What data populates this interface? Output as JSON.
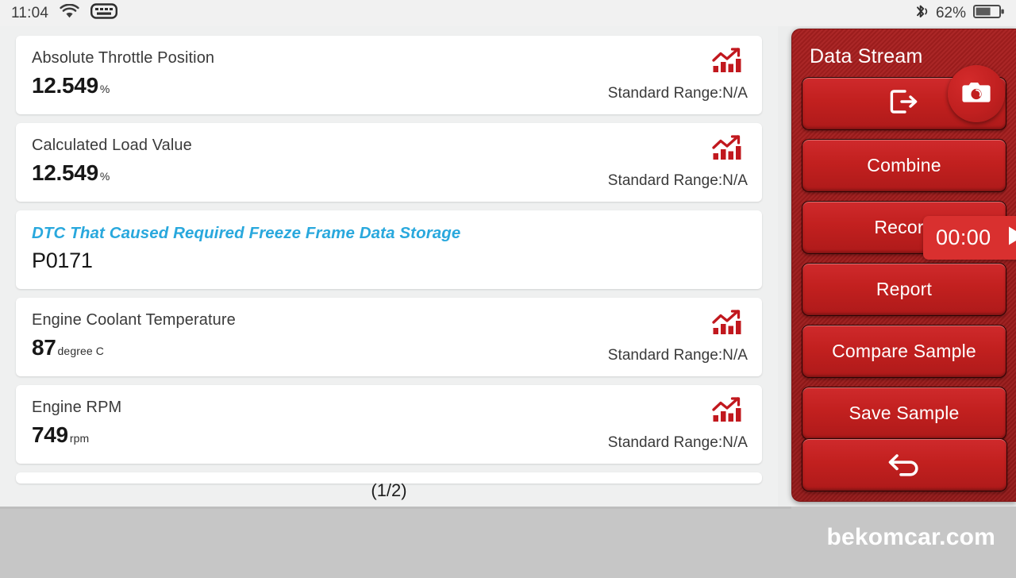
{
  "status_bar": {
    "clock": "11:04",
    "wifi_icon": "wifi-icon",
    "keyboard_icon": "keyboard-icon",
    "bluetooth_icon": "bluetooth-icon",
    "battery_percent": "62%",
    "battery_icon": "battery-icon",
    "battery_level": 62
  },
  "main": {
    "page_indicator": "(1/2)",
    "range_icon": "bar-chart-trend-icon",
    "cards": [
      {
        "label": "Absolute Throttle Position",
        "value": "12.549",
        "unit": "%",
        "range": "Standard Range:N/A",
        "has_chart_icon": true,
        "is_dtc": false
      },
      {
        "label": "Calculated Load Value",
        "value": "12.549",
        "unit": "%",
        "range": "Standard Range:N/A",
        "has_chart_icon": true,
        "is_dtc": false
      },
      {
        "label": "DTC That Caused Required Freeze Frame Data Storage",
        "value": "P0171",
        "unit": "",
        "range": "",
        "has_chart_icon": false,
        "is_dtc": true
      },
      {
        "label": "Engine Coolant Temperature",
        "value": "87",
        "unit": "degree C",
        "range": "Standard Range:N/A",
        "has_chart_icon": true,
        "is_dtc": false
      },
      {
        "label": "Engine RPM",
        "value": "749",
        "unit": "rpm",
        "range": "Standard Range:N/A",
        "has_chart_icon": true,
        "is_dtc": false
      }
    ]
  },
  "panel": {
    "title": "Data Stream",
    "camera_icon": "camera-icon",
    "exit_icon": "exit-icon",
    "back_icon": "back-arrow-icon",
    "buttons": [
      {
        "label": "",
        "icon": "exit-icon"
      },
      {
        "label": "Combine",
        "icon": ""
      },
      {
        "label": "Record",
        "icon": ""
      },
      {
        "label": "Report",
        "icon": ""
      },
      {
        "label": "Compare Sample",
        "icon": ""
      },
      {
        "label": "Save Sample",
        "icon": ""
      }
    ],
    "timer": {
      "time": "00:00",
      "play_icon": "play-icon"
    }
  },
  "footer": {
    "watermark": "bekomcar.com"
  },
  "colors": {
    "panel_red": "#9c1b1b",
    "button_red": "#c2201f",
    "timer_red": "#d9302f",
    "dtc_blue": "#29a8dd",
    "chart_icon_red": "#c1181e",
    "footer_gray": "#c6c6c6",
    "page_bg": "#eff0f0"
  }
}
